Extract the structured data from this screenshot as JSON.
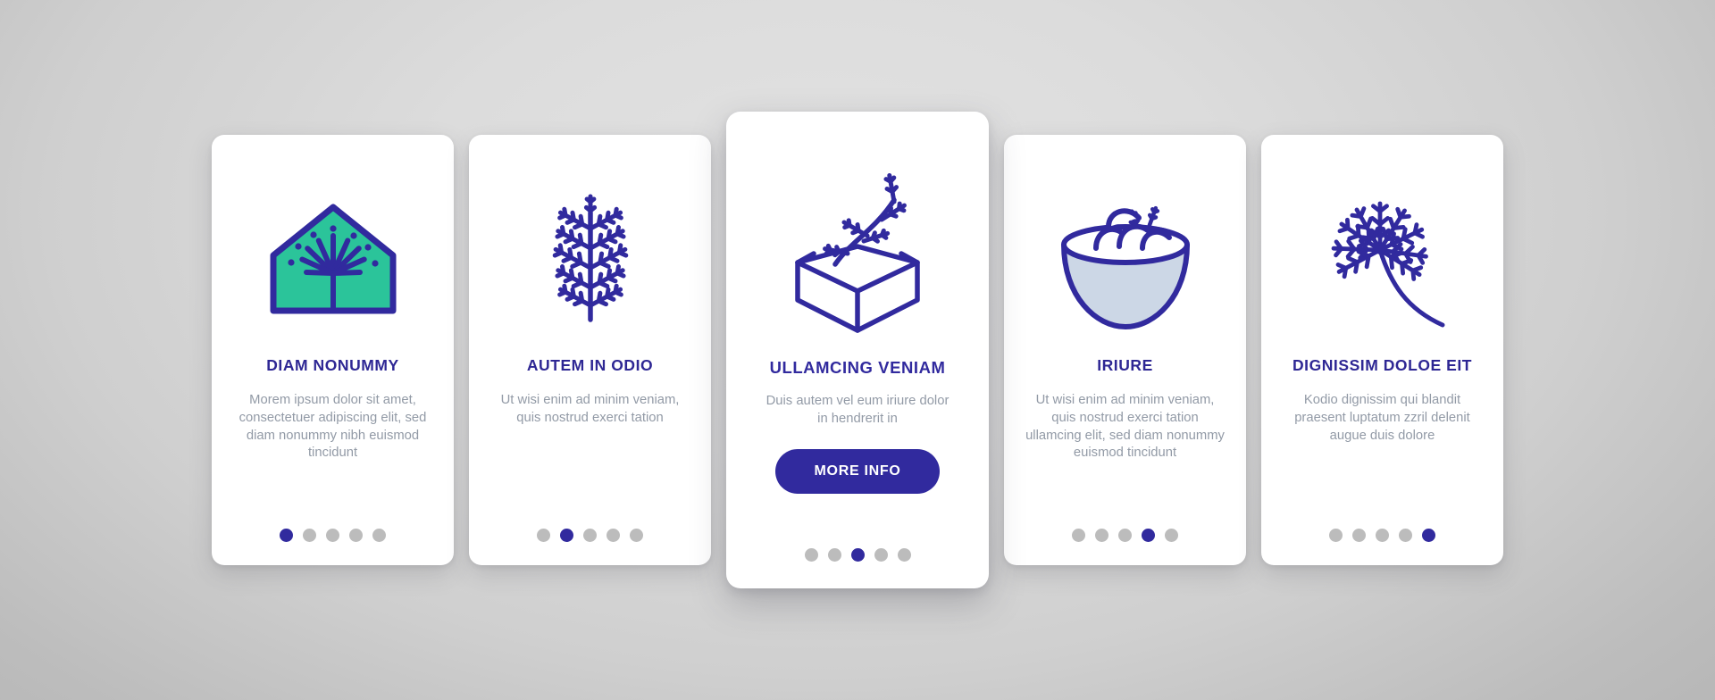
{
  "theme": {
    "brand_purple": "#312a9e",
    "title_purple": "#2e2794",
    "accent_teal": "#2bc49a",
    "bowl_fill": "#ccd7e6",
    "body_text_gray": "#929aa6",
    "dot_inactive": "#bcbcbc",
    "card_background": "#ffffff",
    "page_background": "#d6d6d6"
  },
  "cards": [
    {
      "icon": "greenhouse-icon",
      "title": "DIAM NONUMMY",
      "body": "Morem ipsum dolor sit amet, consectetuer adipiscing elit, sed diam nonummy nibh euismod tincidunt",
      "featured": false,
      "cta": null,
      "dots": {
        "count": 5,
        "active_index": 1
      }
    },
    {
      "icon": "dill-bush-icon",
      "title": "AUTEM IN ODIO",
      "body": "Ut wisi enim ad minim veniam, quis nostrud exerci tation",
      "featured": false,
      "cta": null,
      "dots": {
        "count": 5,
        "active_index": 2
      }
    },
    {
      "icon": "dill-crate-icon",
      "title": "ULLAMCING VENIAM",
      "body": "Duis autem vel eum iriure dolor in hendrerit in",
      "featured": true,
      "cta": "MORE INFO",
      "dots": {
        "count": 5,
        "active_index": 3
      }
    },
    {
      "icon": "dumpling-bowl-icon",
      "title": "IRIURE",
      "body": "Ut wisi enim ad minim veniam, quis nostrud exerci tation ullamcing elit, sed diam nonummy euismod tincidunt",
      "featured": false,
      "cta": null,
      "dots": {
        "count": 5,
        "active_index": 4
      }
    },
    {
      "icon": "dill-flower-icon",
      "title": "DIGNISSIM DOLOE EIT",
      "body": "Kodio dignissim qui blandit praesent luptatum zzril delenit augue duis dolore",
      "featured": false,
      "cta": null,
      "dots": {
        "count": 5,
        "active_index": 5
      }
    }
  ]
}
